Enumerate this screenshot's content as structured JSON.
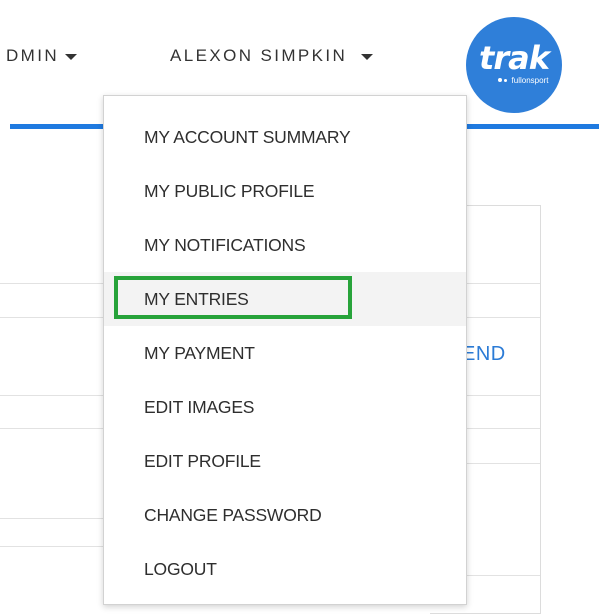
{
  "nav": {
    "admin_label": "DMIN",
    "user_label": "ALEXON SIMPKIN"
  },
  "logo": {
    "word": "trak",
    "sub": "fullonsport",
    "brand_color": "#2f7fd9"
  },
  "background": {
    "send_link": "END"
  },
  "user_menu": {
    "items": [
      {
        "label": "MY ACCOUNT SUMMARY"
      },
      {
        "label": "MY PUBLIC PROFILE"
      },
      {
        "label": "MY NOTIFICATIONS"
      },
      {
        "label": "MY ENTRIES",
        "highlighted": true
      },
      {
        "label": "MY PAYMENT"
      },
      {
        "label": "EDIT IMAGES"
      },
      {
        "label": "EDIT PROFILE"
      },
      {
        "label": "CHANGE PASSWORD"
      },
      {
        "label": "LOGOUT"
      }
    ]
  },
  "colors": {
    "accent_blue": "#1f7ae0",
    "highlight_green": "#27a33a"
  }
}
